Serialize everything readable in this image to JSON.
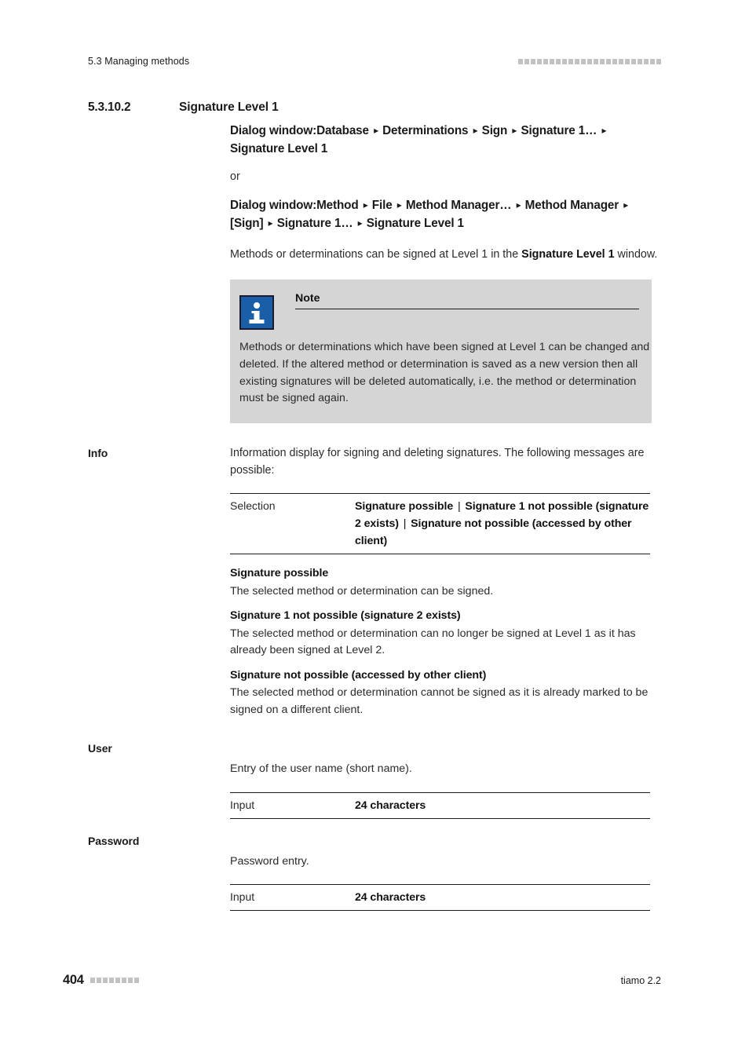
{
  "header": {
    "running_title": "5.3 Managing methods",
    "rule_squares": 23,
    "rule_color": "#c2c2c2"
  },
  "section": {
    "number": "5.3.10.2",
    "title": "Signature Level 1"
  },
  "breadcrumbs": {
    "separator": "▸",
    "path_1": "Dialog window:Database ▸ Determinations ▸ Sign ▸ Signature 1… ▸ Signature Level 1",
    "or_label": "or",
    "path_2": "Dialog window:Method ▸ File ▸ Method Manager… ▸ Method Manager ▸ [Sign] ▸ Signature 1… ▸ Signature Level 1"
  },
  "intro": {
    "text_before": "Methods or determinations can be signed at Level 1 in the ",
    "emphasis": "Signature Level 1",
    "text_after": " window."
  },
  "note": {
    "icon": "info-icon",
    "icon_color": "#1a5ea8",
    "background": "#d5d5d5",
    "title": "Note",
    "text": "Methods or determinations which have been signed at Level 1 can be changed and deleted. If the altered method or determination is saved as a new version then all existing signatures will be deleted automatically, i.e. the method or determination must be signed again."
  },
  "info_section": {
    "label": "Info",
    "description": "Information display for signing and deleting signatures. The following messages are possible:",
    "table": {
      "key": "Selection",
      "value_parts": [
        "Signature possible",
        "Signature 1 not possible (signature 2 exists)",
        "Signature not possible (accessed by other client)"
      ],
      "value_separator": "|"
    },
    "definitions": [
      {
        "term": "Signature possible",
        "description": "The selected method or determination can be signed."
      },
      {
        "term": "Signature 1 not possible (signature 2 exists)",
        "description": "The selected method or determination can no longer be signed at Level 1 as it has already been signed at Level 2."
      },
      {
        "term": "Signature not possible (accessed by other client)",
        "description": "The selected method or determination cannot be signed as it is already marked to be signed on a different client."
      }
    ]
  },
  "user_section": {
    "label": "User",
    "description": "Entry of the user name (short name).",
    "table": {
      "key": "Input",
      "value": "24 characters"
    }
  },
  "password_section": {
    "label": "Password",
    "description": "Password entry.",
    "table": {
      "key": "Input",
      "value": "24 characters"
    }
  },
  "footer": {
    "page_number": "404",
    "rule_squares": 8,
    "rule_color": "#c2c2c2",
    "product": "tiamo 2.2"
  }
}
